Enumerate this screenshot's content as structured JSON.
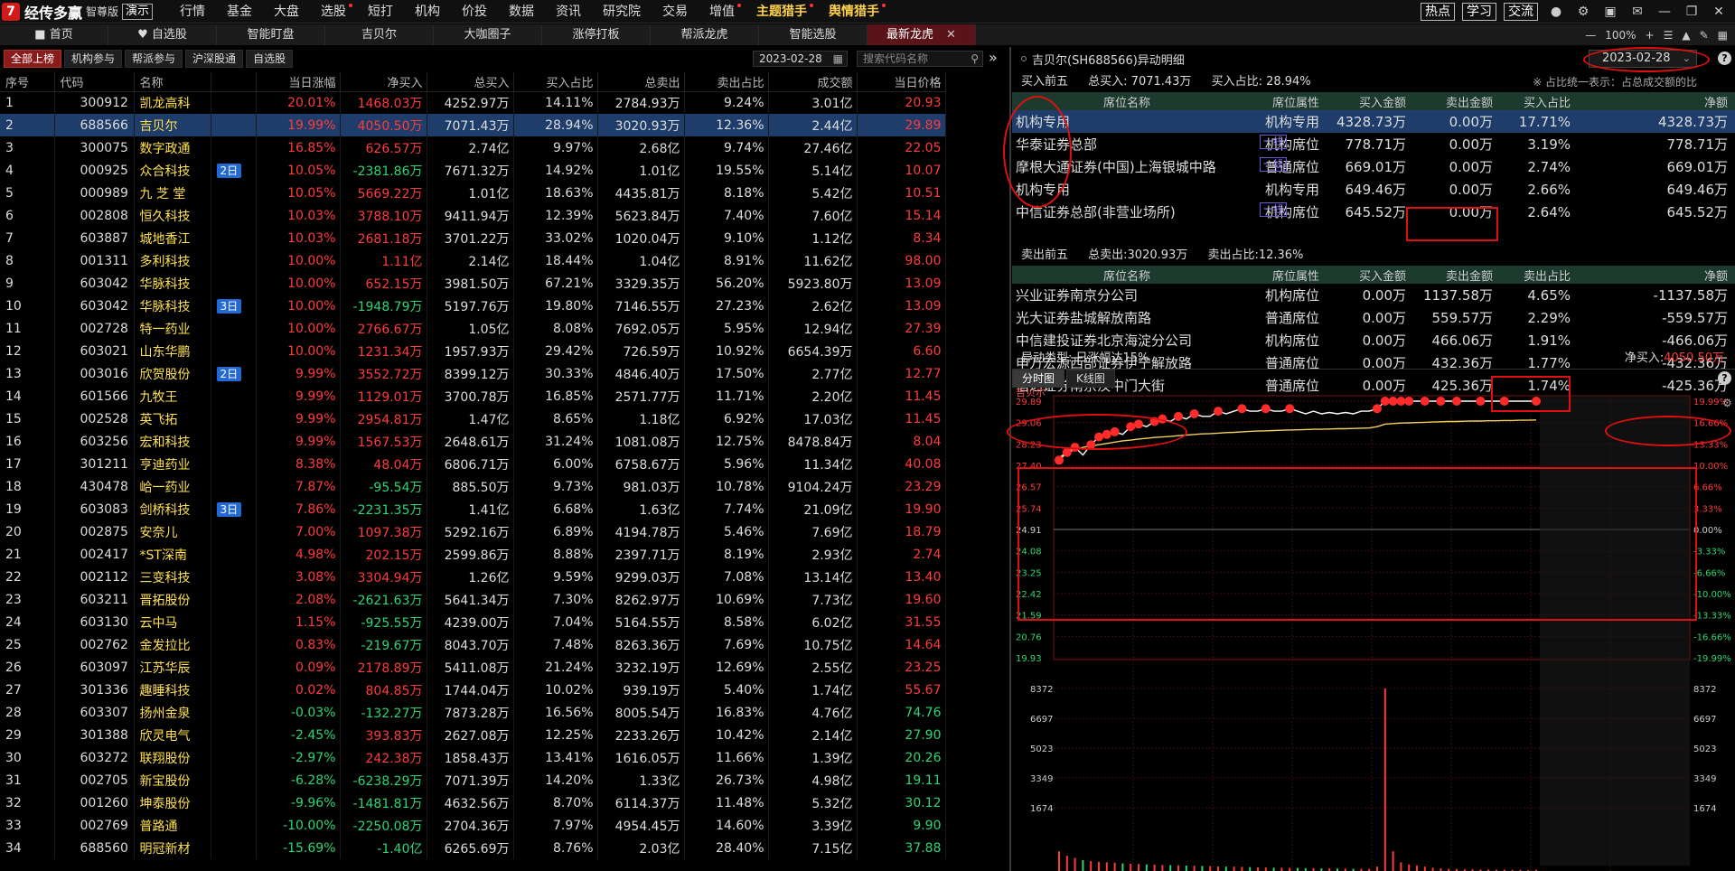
{
  "app": {
    "logo_text": "经传多赢",
    "edition": "智尊版",
    "demo": "演示"
  },
  "menu": [
    {
      "label": "行情",
      "dot": false
    },
    {
      "label": "基金",
      "dot": false
    },
    {
      "label": "大盘",
      "dot": false
    },
    {
      "label": "选股",
      "dot": true
    },
    {
      "label": "短打",
      "dot": false
    },
    {
      "label": "机构",
      "dot": false
    },
    {
      "label": "价投",
      "dot": false
    },
    {
      "label": "数据",
      "dot": false
    },
    {
      "label": "资讯",
      "dot": false
    },
    {
      "label": "研究院",
      "dot": false
    },
    {
      "label": "交易",
      "dot": false
    },
    {
      "label": "增值",
      "dot": true
    },
    {
      "label": "主题猎手",
      "dot": true,
      "highlight": true
    },
    {
      "label": "舆情猎手",
      "dot": true,
      "highlight": true
    }
  ],
  "top_buttons": [
    "热点",
    "学习",
    "交流"
  ],
  "tabs": [
    "首页",
    "自选股",
    "智能盯盘",
    "吉贝尔",
    "大咖圈子",
    "涨停打板",
    "帮派龙虎",
    "智能选股",
    "最新龙虎"
  ],
  "active_tab": "最新龙虎",
  "zoom": "100%",
  "sub_buttons": [
    "全部上榜",
    "机构参与",
    "帮派参与",
    "沪深股通",
    "自选股"
  ],
  "date": "2023-02-28",
  "search_placeholder": "搜索代码名称",
  "table": {
    "headers": [
      "序号",
      "代码",
      "名称",
      "",
      "当日涨幅",
      "净买入",
      "总买入",
      "买入占比",
      "总卖出",
      "卖出占比",
      "成交额",
      "当日价格"
    ],
    "rows": [
      {
        "i": "1",
        "code": "300912",
        "name": "凯龙高科",
        "badge": "",
        "chg": "20.01%",
        "net": "1468.03万",
        "buy": "4252.97万",
        "bp": "14.11%",
        "sell": "2784.93万",
        "sp": "9.24%",
        "amt": "3.01亿",
        "price": "20.93"
      },
      {
        "i": "2",
        "code": "688566",
        "name": "吉贝尔",
        "badge": "",
        "chg": "19.99%",
        "net": "4050.50万",
        "buy": "7071.43万",
        "bp": "28.94%",
        "sell": "3020.93万",
        "sp": "12.36%",
        "amt": "2.44亿",
        "price": "29.89"
      },
      {
        "i": "3",
        "code": "300075",
        "name": "数字政通",
        "badge": "",
        "chg": "16.85%",
        "net": "626.57万",
        "buy": "2.74亿",
        "bp": "9.97%",
        "sell": "2.68亿",
        "sp": "9.74%",
        "amt": "27.46亿",
        "price": "22.05"
      },
      {
        "i": "4",
        "code": "000925",
        "name": "众合科技",
        "badge": "2日",
        "chg": "10.05%",
        "net": "-2381.86万",
        "buy": "7671.32万",
        "bp": "14.92%",
        "sell": "1.01亿",
        "sp": "19.55%",
        "amt": "5.14亿",
        "price": "10.07"
      },
      {
        "i": "5",
        "code": "000989",
        "name": "九 芝 堂",
        "badge": "",
        "chg": "10.05%",
        "net": "5669.22万",
        "buy": "1.01亿",
        "bp": "18.63%",
        "sell": "4435.81万",
        "sp": "8.18%",
        "amt": "5.42亿",
        "price": "10.51"
      },
      {
        "i": "6",
        "code": "002808",
        "name": "恒久科技",
        "badge": "",
        "chg": "10.03%",
        "net": "3788.10万",
        "buy": "9411.94万",
        "bp": "12.39%",
        "sell": "5623.84万",
        "sp": "7.40%",
        "amt": "7.60亿",
        "price": "15.14"
      },
      {
        "i": "7",
        "code": "603887",
        "name": "城地香江",
        "badge": "",
        "chg": "10.03%",
        "net": "2681.18万",
        "buy": "3701.22万",
        "bp": "33.02%",
        "sell": "1020.04万",
        "sp": "9.10%",
        "amt": "1.12亿",
        "price": "8.34"
      },
      {
        "i": "8",
        "code": "001311",
        "name": "多利科技",
        "badge": "",
        "chg": "10.00%",
        "net": "1.11亿",
        "buy": "2.14亿",
        "bp": "18.44%",
        "sell": "1.04亿",
        "sp": "8.91%",
        "amt": "11.62亿",
        "price": "98.00"
      },
      {
        "i": "9",
        "code": "603042",
        "name": "华脉科技",
        "badge": "",
        "chg": "10.00%",
        "net": "652.15万",
        "buy": "3981.50万",
        "bp": "67.21%",
        "sell": "3329.35万",
        "sp": "56.20%",
        "amt": "5923.80万",
        "price": "13.09"
      },
      {
        "i": "10",
        "code": "603042",
        "name": "华脉科技",
        "badge": "3日",
        "chg": "10.00%",
        "net": "-1948.79万",
        "buy": "5197.76万",
        "bp": "19.80%",
        "sell": "7146.55万",
        "sp": "27.23%",
        "amt": "2.62亿",
        "price": "13.09"
      },
      {
        "i": "11",
        "code": "002728",
        "name": "特一药业",
        "badge": "",
        "chg": "10.00%",
        "net": "2766.67万",
        "buy": "1.05亿",
        "bp": "8.08%",
        "sell": "7692.05万",
        "sp": "5.95%",
        "amt": "12.94亿",
        "price": "27.39"
      },
      {
        "i": "12",
        "code": "603021",
        "name": "山东华鹏",
        "badge": "",
        "chg": "10.00%",
        "net": "1231.34万",
        "buy": "1957.93万",
        "bp": "29.42%",
        "sell": "726.59万",
        "sp": "10.92%",
        "amt": "6654.39万",
        "price": "6.60"
      },
      {
        "i": "13",
        "code": "003016",
        "name": "欣贺股份",
        "badge": "2日",
        "chg": "9.99%",
        "net": "3552.72万",
        "buy": "8399.12万",
        "bp": "30.33%",
        "sell": "4846.40万",
        "sp": "17.50%",
        "amt": "2.77亿",
        "price": "12.77"
      },
      {
        "i": "14",
        "code": "601566",
        "name": "九牧王",
        "badge": "",
        "chg": "9.99%",
        "net": "1129.01万",
        "buy": "3700.78万",
        "bp": "16.85%",
        "sell": "2571.77万",
        "sp": "11.71%",
        "amt": "2.20亿",
        "price": "11.45"
      },
      {
        "i": "15",
        "code": "002528",
        "name": "英飞拓",
        "badge": "",
        "chg": "9.99%",
        "net": "2954.81万",
        "buy": "1.47亿",
        "bp": "8.65%",
        "sell": "1.18亿",
        "sp": "6.92%",
        "amt": "17.03亿",
        "price": "11.45"
      },
      {
        "i": "16",
        "code": "603256",
        "name": "宏和科技",
        "badge": "",
        "chg": "9.99%",
        "net": "1567.53万",
        "buy": "2648.61万",
        "bp": "31.24%",
        "sell": "1081.08万",
        "sp": "12.75%",
        "amt": "8478.84万",
        "price": "8.04"
      },
      {
        "i": "17",
        "code": "301211",
        "name": "亨迪药业",
        "badge": "",
        "chg": "8.38%",
        "net": "48.04万",
        "buy": "6806.71万",
        "bp": "6.00%",
        "sell": "6758.67万",
        "sp": "5.96%",
        "amt": "11.34亿",
        "price": "40.08"
      },
      {
        "i": "18",
        "code": "430478",
        "name": "峆一药业",
        "badge": "",
        "chg": "7.87%",
        "net": "-95.54万",
        "buy": "885.50万",
        "bp": "9.73%",
        "sell": "981.03万",
        "sp": "10.78%",
        "amt": "9104.24万",
        "price": "23.29"
      },
      {
        "i": "19",
        "code": "603083",
        "name": "剑桥科技",
        "badge": "3日",
        "chg": "7.86%",
        "net": "-2231.35万",
        "buy": "1.41亿",
        "bp": "6.68%",
        "sell": "1.63亿",
        "sp": "7.74%",
        "amt": "21.09亿",
        "price": "19.90"
      },
      {
        "i": "20",
        "code": "002875",
        "name": "安奈儿",
        "badge": "",
        "chg": "7.00%",
        "net": "1097.38万",
        "buy": "5292.16万",
        "bp": "6.89%",
        "sell": "4194.78万",
        "sp": "5.46%",
        "amt": "7.69亿",
        "price": "18.79"
      },
      {
        "i": "21",
        "code": "002417",
        "name": "*ST深南",
        "badge": "",
        "chg": "4.98%",
        "net": "202.15万",
        "buy": "2599.86万",
        "bp": "8.88%",
        "sell": "2397.71万",
        "sp": "8.19%",
        "amt": "2.93亿",
        "price": "2.74"
      },
      {
        "i": "22",
        "code": "002112",
        "name": "三变科技",
        "badge": "",
        "chg": "3.08%",
        "net": "3304.94万",
        "buy": "1.26亿",
        "bp": "9.59%",
        "sell": "9299.03万",
        "sp": "7.08%",
        "amt": "13.14亿",
        "price": "13.40"
      },
      {
        "i": "23",
        "code": "603211",
        "name": "晋拓股份",
        "badge": "",
        "chg": "2.08%",
        "net": "-2621.63万",
        "buy": "5641.34万",
        "bp": "7.30%",
        "sell": "8262.97万",
        "sp": "10.69%",
        "amt": "7.73亿",
        "price": "19.60"
      },
      {
        "i": "24",
        "code": "603130",
        "name": "云中马",
        "badge": "",
        "chg": "1.15%",
        "net": "-925.55万",
        "buy": "4239.00万",
        "bp": "7.04%",
        "sell": "5164.55万",
        "sp": "8.58%",
        "amt": "6.02亿",
        "price": "31.55"
      },
      {
        "i": "25",
        "code": "002762",
        "name": "金发拉比",
        "badge": "",
        "chg": "0.83%",
        "net": "-219.67万",
        "buy": "8043.70万",
        "bp": "7.48%",
        "sell": "8263.36万",
        "sp": "7.69%",
        "amt": "10.75亿",
        "price": "14.64"
      },
      {
        "i": "26",
        "code": "603097",
        "name": "江苏华辰",
        "badge": "",
        "chg": "0.09%",
        "net": "2178.89万",
        "buy": "5411.08万",
        "bp": "21.24%",
        "sell": "3232.19万",
        "sp": "12.69%",
        "amt": "2.55亿",
        "price": "23.25"
      },
      {
        "i": "27",
        "code": "301336",
        "name": "趣睡科技",
        "badge": "",
        "chg": "0.02%",
        "net": "804.85万",
        "buy": "1744.04万",
        "bp": "10.02%",
        "sell": "939.19万",
        "sp": "5.40%",
        "amt": "1.74亿",
        "price": "55.67"
      },
      {
        "i": "28",
        "code": "603307",
        "name": "扬州金泉",
        "badge": "",
        "chg": "-0.03%",
        "net": "-132.27万",
        "buy": "7873.28万",
        "bp": "16.56%",
        "sell": "8005.54万",
        "sp": "16.83%",
        "amt": "4.76亿",
        "price": "74.76"
      },
      {
        "i": "29",
        "code": "301388",
        "name": "欣灵电气",
        "badge": "",
        "chg": "-2.45%",
        "net": "393.83万",
        "buy": "2627.08万",
        "bp": "12.25%",
        "sell": "2233.26万",
        "sp": "10.42%",
        "amt": "2.14亿",
        "price": "27.90"
      },
      {
        "i": "30",
        "code": "603272",
        "name": "联翔股份",
        "badge": "",
        "chg": "-2.97%",
        "net": "242.38万",
        "buy": "1858.43万",
        "bp": "13.41%",
        "sell": "1616.05万",
        "sp": "11.66%",
        "amt": "1.39亿",
        "price": "20.26"
      },
      {
        "i": "31",
        "code": "002705",
        "name": "新宝股份",
        "badge": "",
        "chg": "-6.28%",
        "net": "-6238.29万",
        "buy": "7071.39万",
        "bp": "14.20%",
        "sell": "1.33亿",
        "sp": "26.73%",
        "amt": "4.98亿",
        "price": "19.11"
      },
      {
        "i": "32",
        "code": "001260",
        "name": "坤泰股份",
        "badge": "",
        "chg": "-9.96%",
        "net": "-1481.81万",
        "buy": "4632.56万",
        "bp": "8.70%",
        "sell": "6114.37万",
        "sp": "11.48%",
        "amt": "5.32亿",
        "price": "30.12"
      },
      {
        "i": "33",
        "code": "002769",
        "name": "普路通",
        "badge": "",
        "chg": "-10.00%",
        "net": "-2250.08万",
        "buy": "2704.36万",
        "bp": "7.97%",
        "sell": "4954.45万",
        "sp": "14.60%",
        "amt": "3.39亿",
        "price": "9.90"
      },
      {
        "i": "34",
        "code": "688560",
        "name": "明冠新材",
        "badge": "",
        "chg": "-15.69%",
        "net": "-1.40亿",
        "buy": "6265.69万",
        "bp": "8.76%",
        "sell": "2.03亿",
        "sp": "28.40%",
        "amt": "7.15亿",
        "price": "37.88"
      }
    ]
  },
  "detail": {
    "title": "吉贝尔(SH688566)异动明细",
    "date": "2023-02-28",
    "buy_summary": {
      "label": "买入前五",
      "total": "总买入: 7071.43万",
      "ratio": "买入占比: 28.94%"
    },
    "note": "※ 占比统一表示：占总成交额的比",
    "headers": [
      "席位名称",
      "席位属性",
      "买入金额",
      "卖出金额",
      "买入占比",
      "净额"
    ],
    "sell_headers": [
      "席位名称",
      "席位属性",
      "买入金额",
      "卖出金额",
      "卖出占比",
      "净额"
    ],
    "buy_rows": [
      {
        "name": "机构专用",
        "tag": "",
        "attr": "机构专用",
        "buy": "4328.73万",
        "sell": "0.00万",
        "ratio": "17.71%",
        "net": "4328.73万"
      },
      {
        "name": "华泰证券总部",
        "tag": "一线",
        "attr": "机构席位",
        "buy": "778.71万",
        "sell": "0.00万",
        "ratio": "3.19%",
        "net": "778.71万"
      },
      {
        "name": "摩根大通证券(中国)上海银城中路",
        "tag": "一线",
        "attr": "普通席位",
        "buy": "669.01万",
        "sell": "0.00万",
        "ratio": "2.74%",
        "net": "669.01万"
      },
      {
        "name": "机构专用",
        "tag": "",
        "attr": "机构专用",
        "buy": "649.46万",
        "sell": "0.00万",
        "ratio": "2.66%",
        "net": "649.46万"
      },
      {
        "name": "中信证券总部(非营业场所)",
        "tag": "一线",
        "attr": "机构席位",
        "buy": "645.52万",
        "sell": "0.00万",
        "ratio": "2.64%",
        "net": "645.52万"
      }
    ],
    "sell_summary": {
      "label": "卖出前五",
      "total": "总卖出:3020.93万",
      "ratio": "卖出占比:12.36%"
    },
    "sell_rows": [
      {
        "name": "兴业证券南京分公司",
        "attr": "机构席位",
        "buy": "0.00万",
        "sell": "1137.58万",
        "ratio": "4.65%",
        "net": "-1137.58万"
      },
      {
        "name": "光大证券盐城解放南路",
        "attr": "普通席位",
        "buy": "0.00万",
        "sell": "559.57万",
        "ratio": "2.29%",
        "net": "-559.57万"
      },
      {
        "name": "中信建投证券北京海淀分公司",
        "attr": "机构席位",
        "buy": "0.00万",
        "sell": "466.06万",
        "ratio": "1.91%",
        "net": "-466.06万"
      },
      {
        "name": "申万宏源西部证券伊宁解放路",
        "attr": "普通席位",
        "buy": "0.00万",
        "sell": "432.36万",
        "ratio": "1.77%",
        "net": "-432.36万"
      },
      {
        "name": "信达证券南京汉中门大街",
        "attr": "普通席位",
        "buy": "0.00万",
        "sell": "425.36万",
        "ratio": "1.74%",
        "net": "-425.36万"
      }
    ],
    "anomaly_label": "异动类型:",
    "anomaly_value": "日涨幅达15%",
    "net_label": "净买入:",
    "net_value": "4050.50万"
  },
  "chart_tabs": [
    "分时图",
    "K线图"
  ],
  "chart_data": {
    "type": "line",
    "stock_label": "吉贝尔",
    "price_ticks": [
      "29.89",
      "29.06",
      "28.23",
      "27.40",
      "26.57",
      "25.74",
      "24.91",
      "24.08",
      "23.25",
      "22.42",
      "21.59",
      "20.76",
      "19.93"
    ],
    "pct_ticks": [
      "19.99%",
      "16.66%",
      "13.33%",
      "10.00%",
      "6.66%",
      "3.33%",
      "0.00%",
      "-3.33%",
      "-6.66%",
      "-10.00%",
      "-13.33%",
      "-16.66%",
      "-19.99%"
    ],
    "volume_ticks": [
      "8372",
      "6697",
      "5023",
      "3349",
      "1674"
    ],
    "ylim": [
      19.93,
      29.89
    ],
    "price": [
      27.6,
      27.9,
      28.1,
      27.8,
      28.2,
      28.5,
      28.6,
      28.7,
      28.6,
      28.9,
      29.0,
      28.9,
      29.1,
      29.2,
      29.1,
      29.3,
      29.2,
      29.4,
      29.3,
      29.3,
      29.5,
      29.4,
      29.5,
      29.6,
      29.5,
      29.5,
      29.6,
      29.5,
      29.5,
      29.6,
      29.5,
      29.4,
      29.5,
      29.4,
      29.45,
      29.4,
      29.45,
      29.4,
      29.5,
      29.5,
      29.6,
      29.89,
      29.89,
      29.89,
      29.89,
      29.89,
      29.89,
      29.89,
      29.89,
      29.89,
      29.89,
      29.89,
      29.89,
      29.89,
      29.89,
      29.89,
      29.89,
      29.89,
      29.89,
      29.89,
      29.89
    ],
    "avg_price": [
      27.7,
      27.9,
      28.0,
      28.1,
      28.15,
      28.2,
      28.25,
      28.3,
      28.35,
      28.38,
      28.42,
      28.45,
      28.48,
      28.5,
      28.52,
      28.55,
      28.57,
      28.6,
      28.62,
      28.63,
      28.65,
      28.67,
      28.68,
      28.7,
      28.72,
      28.73,
      28.74,
      28.75,
      28.76,
      28.77,
      28.78,
      28.79,
      28.8,
      28.8,
      28.81,
      28.82,
      28.82,
      28.83,
      28.84,
      28.85,
      28.9,
      29.0,
      29.02,
      29.04,
      29.05,
      29.06,
      29.07,
      29.08,
      29.09,
      29.1,
      29.1,
      29.11,
      29.12,
      29.12,
      29.13,
      29.13,
      29.14,
      29.14,
      29.15,
      29.15,
      29.16
    ],
    "volume": [
      900,
      700,
      600,
      500,
      450,
      420,
      400,
      380,
      350,
      330,
      320,
      300,
      290,
      280,
      270,
      260,
      250,
      240,
      230,
      220,
      210,
      200,
      200,
      190,
      180,
      170,
      160,
      150,
      150,
      140,
      140,
      130,
      130,
      120,
      120,
      110,
      110,
      100,
      100,
      100,
      200,
      8372,
      900,
      400,
      300,
      250,
      200,
      150,
      120,
      100,
      90,
      80,
      80,
      70,
      70,
      60,
      60,
      50,
      50,
      40,
      60
    ],
    "markers_at": [
      0,
      1,
      2,
      4,
      5,
      6,
      7,
      9,
      10,
      12,
      13,
      15,
      17,
      20,
      23,
      26,
      29,
      40,
      41,
      42,
      43,
      44,
      46,
      48,
      50,
      53,
      56,
      60
    ]
  }
}
